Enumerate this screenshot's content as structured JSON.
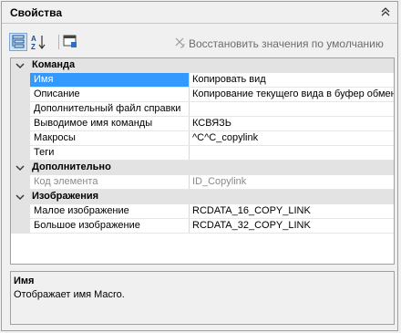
{
  "panel": {
    "title": "Свойства",
    "collapse_icon": "double-chevron-up-icon"
  },
  "toolbar": {
    "categorized_icon": "categorized-view-icon",
    "alphabetical_icon": "sort-az-icon",
    "property_pages_icon": "property-pages-icon",
    "restore_defaults_label": "Восстановить значения по умолчанию",
    "restore_defaults_icon": "reset-icon",
    "restore_enabled": false
  },
  "grid": {
    "categories": [
      {
        "label": "Команда",
        "expanded": true,
        "properties": [
          {
            "name": "Имя",
            "value": "Копировать вид",
            "selected": true
          },
          {
            "name": "Описание",
            "value": "Копирование текущего вида в буфер обмен"
          },
          {
            "name": "Дополнительный файл справки",
            "value": ""
          },
          {
            "name": "Выводимое имя команды",
            "value": "КСВЯЗЬ"
          },
          {
            "name": "Макросы",
            "value": "^C^C_copylink"
          },
          {
            "name": "Теги",
            "value": ""
          }
        ]
      },
      {
        "label": "Дополнительно",
        "expanded": true,
        "properties": [
          {
            "name": "Код элемента",
            "value": "ID_Copylink",
            "disabled": true
          }
        ]
      },
      {
        "label": "Изображения",
        "expanded": true,
        "properties": [
          {
            "name": "Малое изображение",
            "value": "RCDATA_16_COPY_LINK"
          },
          {
            "name": "Большое изображение",
            "value": "RCDATA_32_COPY_LINK"
          }
        ]
      }
    ]
  },
  "description": {
    "title": "Имя",
    "text": "Отображает имя Macro."
  },
  "colors": {
    "selection": "#3399ff",
    "category_bg": "#e3e3e3",
    "disabled_text": "#8a8a8a"
  }
}
